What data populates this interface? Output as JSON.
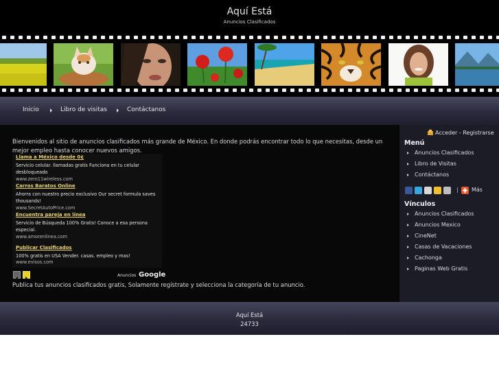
{
  "site": {
    "title": "Aquí Está",
    "subtitle": "Anuncios Clasificados"
  },
  "filmstrip": {
    "frames": [
      "yellow-flower-field",
      "kitten-in-basket",
      "woman-face",
      "red-poppies",
      "tropical-beach",
      "tiger-face",
      "smiling-woman",
      "mountain-lake"
    ]
  },
  "nav": {
    "items": [
      "Inicio",
      "Libro de visitas",
      "Contáctanos"
    ]
  },
  "main": {
    "welcome": "Bienvenidos al sitio de anuncios clasificados más grande de México. En donde podrás encontrar todo lo que necesitas, desde un mejor empleo hasta conocer nuevos amigos.",
    "publish_text": "Publica tus anuncios clasificados gratis, Solamente regístrate y selecciona la categoría de tu anuncio."
  },
  "ads": {
    "items": [
      {
        "title": "Llama a México desde 0¢",
        "desc": "Servicio celular. llamadas gratis Funciona en tu celular desbloqueado",
        "url": "www.zero11wireless.com"
      },
      {
        "title": "Carros Baratos Online",
        "desc": "Ahorra con nuestro precio exclusivo Our secret formula saves thousands!",
        "url": "www.SecretAutoPrice.com"
      },
      {
        "title": "Encuentra pareja en línea",
        "desc": "Servicio de Búsqueda 100% Gratis! Conoce a esa persona especial.",
        "url": "www.amorenlinea.com"
      },
      {
        "title": "Publicar Clasificados",
        "desc": "100% gratis en USA Vender. casas. empleo y mas!",
        "url": "www.evisos.com"
      }
    ],
    "by_label": "Anuncios",
    "google_label": "Google"
  },
  "sidebar": {
    "login_text": "Acceder - Registrarse",
    "menu_heading": "Menú",
    "menu_items": [
      "Anuncios Clasificados",
      "Libro de Visitas",
      "Contáctanos"
    ],
    "share_separator": "|",
    "share_more": "Más",
    "links_heading": "Vínculos",
    "link_items": [
      "Anuncios Clasificados",
      "Anuncios Mexico",
      "CineNet",
      "Casas de Vacaciones",
      "Cachonga",
      "Paginas Web Gratis"
    ]
  },
  "footer": {
    "title": "Aquí Está",
    "count": "24733"
  },
  "colors": {
    "header_bg": "#000000",
    "nav_bg": "#2b2b3d",
    "sidebar_bg": "#1c1c27",
    "ad_title": "#e8d36a"
  }
}
